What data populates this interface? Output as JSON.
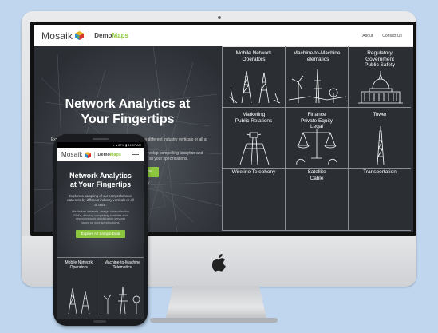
{
  "desktop": {
    "brand": "Mosaik",
    "brand_sub_a": "Demo",
    "brand_sub_b": "Maps",
    "nav": [
      "About",
      "Contact Us"
    ],
    "hero_title_1": "Network Analytics at",
    "hero_title_2": "Your Fingertips",
    "hero_text": "Explore a sampling of our comprehensive data sets by different industry verticals or all at once.",
    "hero_text2": "We deliver datasets, design data collection SDKs, develop compelling analytics and deploy network visualization services based on your specifications.",
    "cta_label": "Data",
    "caption": "ke City",
    "tiles": [
      [
        "Mobile Network",
        "Operators"
      ],
      [
        "Machine-to-Machine",
        "Telematics"
      ],
      [
        "Regulatory",
        "Government",
        "Public Safety"
      ],
      [
        "Marketing",
        "Public Relations"
      ],
      [
        "Finance",
        "Private Equity",
        "Legal"
      ],
      [
        "Tower"
      ],
      [
        "Wireline Telephony"
      ],
      [
        "Satellite",
        "Cable"
      ],
      [
        "Transportation"
      ]
    ]
  },
  "phone": {
    "status": "▾ ◂ 87% ▮ 11:07 AM",
    "brand": "Mosaik",
    "brand_sub_a": "Demo",
    "brand_sub_b": "Maps",
    "hero_title_1": "Network Analytics",
    "hero_title_2": "at Your Fingertips",
    "hero_text": "Explore a sampling of our comprehensive data sets by different industry verticals or all at once.",
    "hero_text2": "We deliver datasets, design data collection SDKs, develop compelling analytics and deploy network visualization services based on your specifications.",
    "cta_label": "Explore All Sample Data",
    "tiles": [
      [
        "Mobile Network",
        "Operators"
      ],
      [
        "Machine-to-Machine",
        "Telematics"
      ]
    ]
  },
  "colors": {
    "accent": "#8cc63f",
    "dark_bg": "#2b2e33",
    "page_bg": "#bfd6ee"
  }
}
